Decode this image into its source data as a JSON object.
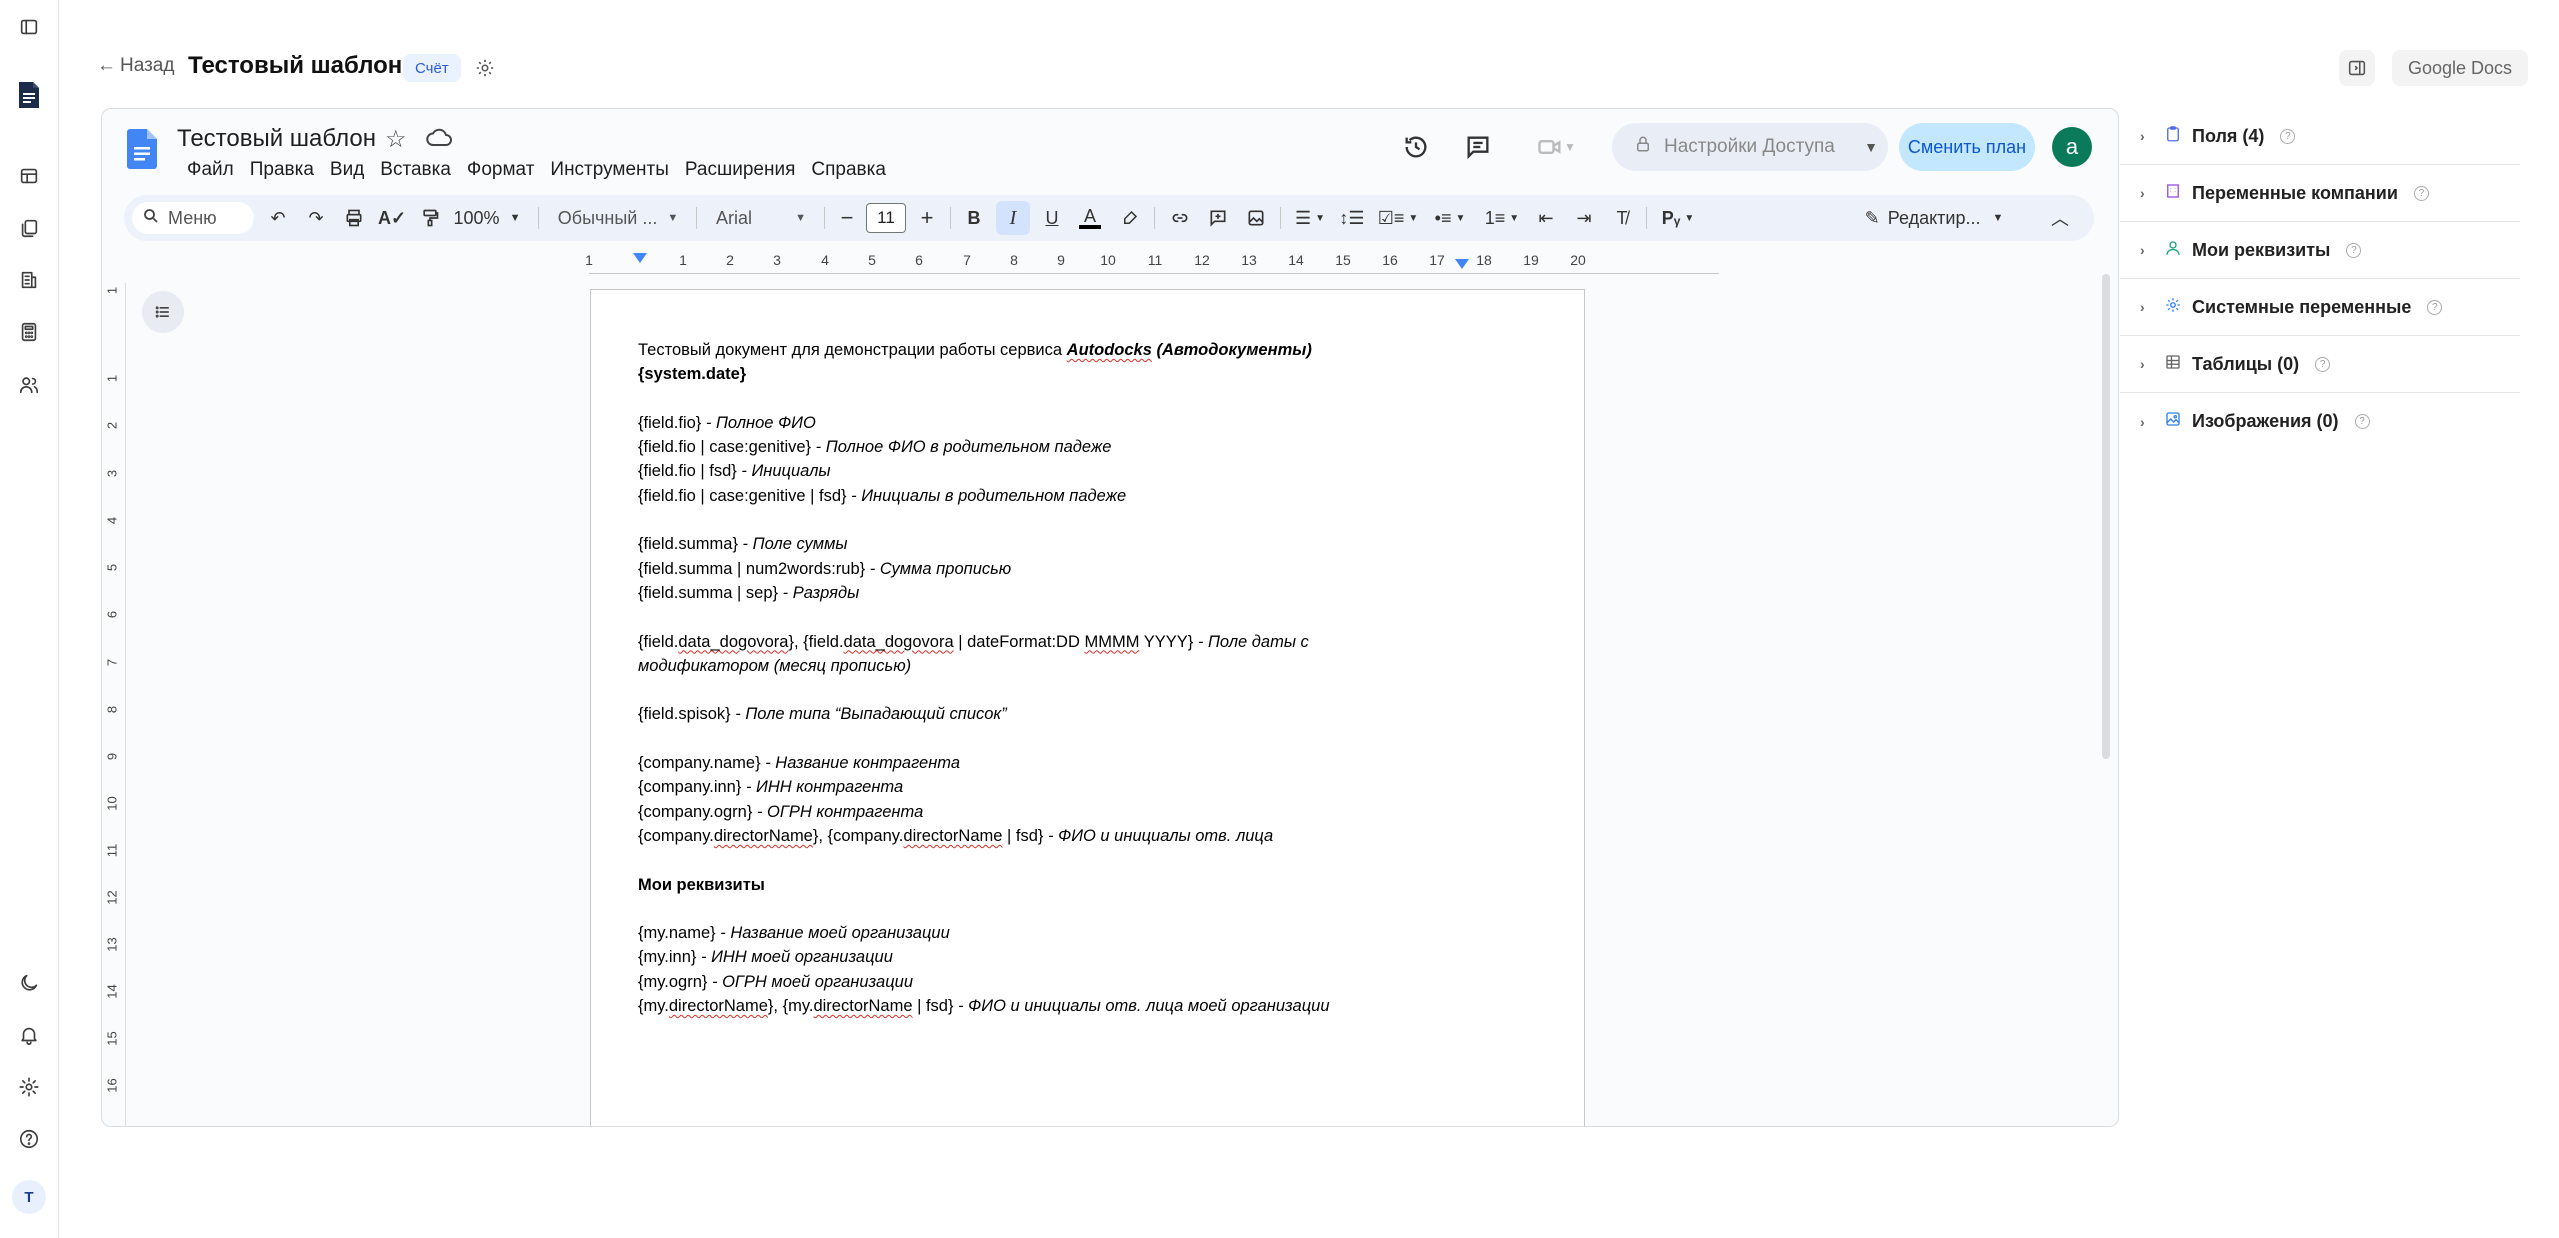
{
  "rail": {
    "icons": [
      "sidebar-toggle-icon",
      "document-logo-icon",
      "dashboard-icon",
      "documents-icon",
      "building-icon",
      "calculator-icon",
      "users-icon",
      "moon-icon",
      "bell-icon",
      "settings-icon",
      "help-icon"
    ],
    "avatar_letter": "T"
  },
  "header": {
    "back_label": "Назад",
    "title": "Тестовый шаблон",
    "badge": "Счёт",
    "gdocs_button": "Google Docs"
  },
  "gdocs": {
    "doc_title": "Тестовый шаблон",
    "menu": [
      "Файл",
      "Правка",
      "Вид",
      "Вставка",
      "Формат",
      "Инструменты",
      "Расширения",
      "Справка"
    ],
    "access_button": "Настройки Доступа",
    "plan_button": "Сменить план",
    "avatar_letter": "a",
    "toolbar": {
      "search_label": "Меню",
      "zoom": "100%",
      "style": "Обычный ...",
      "font": "Arial",
      "font_size": "11",
      "mode": "Редактир..."
    },
    "ruler_numbers": [
      "1",
      "1",
      "2",
      "3",
      "4",
      "5",
      "6",
      "7",
      "8",
      "9",
      "10",
      "11",
      "12",
      "13",
      "14",
      "15",
      "16",
      "17",
      "18",
      "19",
      "20"
    ],
    "vruler_numbers": [
      "1",
      "1",
      "2",
      "3",
      "4",
      "5",
      "6",
      "7",
      "8",
      "9",
      "10",
      "11",
      "12",
      "13",
      "14",
      "15",
      "16"
    ]
  },
  "document": {
    "intro": "Тестовый документ для демонстрации работы сервиса ",
    "intro_brand": "Autodocks",
    "intro_brand_suffix": " (Автодокументы)",
    "system_date": "{system.date}",
    "fio": [
      {
        "code": "{field.fio}",
        "desc": " - Полное ФИО"
      },
      {
        "code": "{field.fio | case:genitive}",
        "desc": " - Полное ФИО в родительном падеже"
      },
      {
        "code": "{field.fio | fsd}",
        "desc": " - Инициалы"
      },
      {
        "code": "{field.fio | case:genitive | fsd}",
        "desc": " - Инициалы в родительном падеже"
      }
    ],
    "summa": [
      {
        "code": "{field.summa}",
        "desc": " - Поле суммы"
      },
      {
        "code": "{field.summa | num2words:rub}",
        "desc": " - Сумма прописью"
      },
      {
        "code": "{field.summa | sep}",
        "desc": " - Разряды"
      }
    ],
    "date_line1_a": "{field.",
    "date_line1_b": "data_dogovora",
    "date_line1_c": "}, {field.",
    "date_line1_d": "data_dogovora",
    "date_line1_e": " | dateFormat:DD ",
    "date_line1_f": "MMMM",
    "date_line1_g": " YYYY}",
    "date_line1_desc": " - Поле даты с",
    "date_line2": "модификатором (месяц прописью)",
    "spisok_code": "{field.spisok}",
    "spisok_desc": " - Поле типа “Выпадающий список”",
    "company": [
      {
        "code": "{company.name}",
        "desc": " - Название контрагента"
      },
      {
        "code": "{company.inn}",
        "desc": " - ИНН контрагента"
      },
      {
        "code": "{company.ogrn}",
        "desc": " - ОГРН контрагента"
      }
    ],
    "company_dir_a": "{company.",
    "company_dir_b": "directorName",
    "company_dir_c": "}, {company.",
    "company_dir_d": "directorName",
    "company_dir_e": " | fsd}",
    "company_dir_desc": " - ФИО и инициалы отв. лица",
    "my_heading": "Мои реквизиты",
    "my": [
      {
        "code": "{my.name}",
        "desc": " - Название моей организации"
      },
      {
        "code": "{my.inn}",
        "desc": " - ИНН моей организации"
      },
      {
        "code": "{my.ogrn}",
        "desc": " - ОГРН моей организации"
      }
    ],
    "my_dir_a": "{my.",
    "my_dir_b": "directorName",
    "my_dir_c": "}, {my.",
    "my_dir_d": "directorName",
    "my_dir_e": " | fsd}",
    "my_dir_desc": " - ФИО и инициалы отв. лица моей организации"
  },
  "panel": {
    "items": [
      {
        "label": "Поля (4)",
        "icon": "clipboard-icon",
        "color": "#4f6bed"
      },
      {
        "label": "Переменные компании",
        "icon": "building-icon",
        "color": "#9b51e0"
      },
      {
        "label": "Мои реквизиты",
        "icon": "user-icon",
        "color": "#1aa37a"
      },
      {
        "label": "Системные переменные",
        "icon": "gear-icon",
        "color": "#2f80ed"
      },
      {
        "label": "Таблицы (0)",
        "icon": "table-icon",
        "color": "#666666"
      },
      {
        "label": "Изображения (0)",
        "icon": "image-icon",
        "color": "#2f80ed"
      }
    ]
  }
}
